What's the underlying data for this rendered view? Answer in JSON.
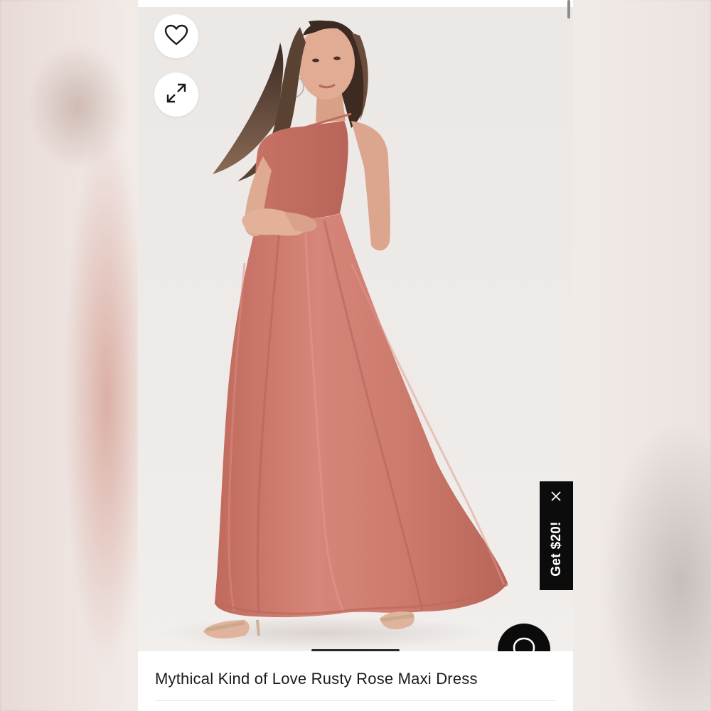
{
  "product": {
    "title": "Mythical Kind of Love Rusty Rose Maxi Dress",
    "image_alt": "Model wearing a rusty rose chiffon maxi dress"
  },
  "actions": {
    "wishlist_icon": "heart-icon",
    "expand_icon": "expand-arrows-icon",
    "chat_icon": "chat-bubble-icon"
  },
  "promo": {
    "label": "Get $20!",
    "close_icon": "close-icon"
  },
  "colors": {
    "dress": "#cf7b6c",
    "promo_bg": "#0c0c0c",
    "chat_bg": "#0b0b0b"
  }
}
